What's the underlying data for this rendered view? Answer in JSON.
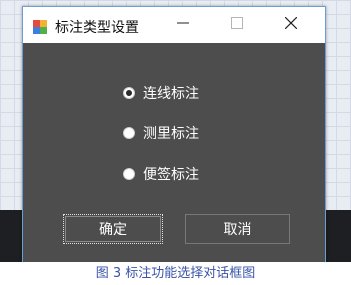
{
  "window": {
    "title": "标注类型设置",
    "app_icon": "app-icon",
    "minimize_icon": "minimize-icon",
    "maximize_icon": "maximize-icon",
    "close_icon": "close-icon"
  },
  "options": [
    {
      "label": "连线标注",
      "checked": true
    },
    {
      "label": "测里标注",
      "checked": false
    },
    {
      "label": "便签标注",
      "checked": false
    }
  ],
  "buttons": {
    "ok": "确定",
    "cancel": "取消"
  },
  "caption": "图 3  标注功能选择对话框图",
  "colors": {
    "dialog_bg": "#4d4d4d",
    "titlebar_bg": "#ffffff",
    "border_accent": "#6b9fd4",
    "caption_text": "#3a53a8"
  }
}
